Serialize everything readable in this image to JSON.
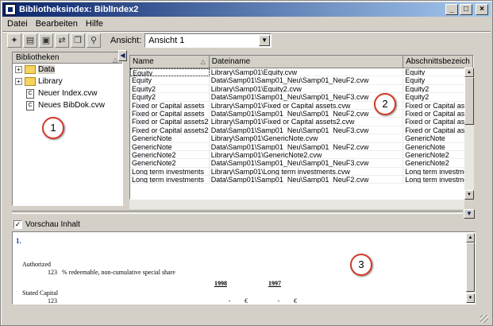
{
  "window": {
    "title": "Bibliotheksindex: BiblIndex2"
  },
  "menu": [
    "Datei",
    "Bearbeiten",
    "Hilfe"
  ],
  "toolbar": {
    "icons": [
      "new-library-icon",
      "library-list-icon",
      "monitor-icon",
      "connection-icon",
      "copy-icon",
      "binoculars-icon"
    ],
    "ansicht_label": "Ansicht:",
    "ansicht_value": "Ansicht 1"
  },
  "library_tree": {
    "header": "Bibliotheken",
    "items": [
      {
        "label": "Data",
        "type": "folder",
        "expandable": true,
        "selected": true
      },
      {
        "label": "Library",
        "type": "folder",
        "expandable": true,
        "selected": false
      },
      {
        "label": "Neuer Index.cvw",
        "type": "doc",
        "expandable": false,
        "selected": false
      },
      {
        "label": "Neues BibDok.cvw",
        "type": "doc",
        "expandable": false,
        "selected": false
      }
    ]
  },
  "table": {
    "headers": [
      "Name",
      "Dateiname",
      "Abschnittsbezeich"
    ],
    "rows": [
      [
        "Equity",
        "Library\\Samp01\\Equity.cvw",
        "Equity"
      ],
      [
        "Equity",
        "Data\\Samp01\\Samp01_Neu\\Samp01_NeuF2.cvw",
        "Equity"
      ],
      [
        "Equity2",
        "Library\\Samp01\\Equity2.cvw",
        "Equity2"
      ],
      [
        "Equity2",
        "Data\\Samp01\\Samp01_Neu\\Samp01_NeuF3.cvw",
        "Equity2"
      ],
      [
        "Fixed or Capital assets",
        "Library\\Samp01\\Fixed or Capital assets.cvw",
        "Fixed or Capital ass"
      ],
      [
        "Fixed or Capital assets",
        "Data\\Samp01\\Samp01_Neu\\Samp01_NeuF2.cvw",
        "Fixed or Capital ass"
      ],
      [
        "Fixed or Capital assets2",
        "Library\\Samp01\\Fixed or Capital assets2.cvw",
        "Fixed or Capital ass"
      ],
      [
        "Fixed or Capital assets2",
        "Data\\Samp01\\Samp01_Neu\\Samp01_NeuF3.cvw",
        "Fixed or Capital ass"
      ],
      [
        "GenericNote",
        "Library\\Samp01\\GenericNote.cvw",
        "GenericNote"
      ],
      [
        "GenericNote",
        "Data\\Samp01\\Samp01_Neu\\Samp01_NeuF2.cvw",
        "GenericNote"
      ],
      [
        "GenericNote2",
        "Library\\Samp01\\GenericNote2.cvw",
        "GenericNote2"
      ],
      [
        "GenericNote2",
        "Data\\Samp01\\Samp01_Neu\\Samp01_NeuF3.cvw",
        "GenericNote2"
      ],
      [
        "Long term investments",
        "Library\\Samp01\\Long term investments.cvw",
        "Long term investme"
      ],
      [
        "Long term investments",
        "Data\\Samp01\\Samp01_Neu\\Samp01_NeuF2.cvw",
        "Long term investme"
      ]
    ]
  },
  "preview": {
    "checkbox_label": "Vorschau Inhalt",
    "number": "1.",
    "authorized": "Authorized",
    "auth_value": "123",
    "auth_desc": "% redeemable, non-cumulative special share",
    "year1": "1998",
    "year2": "1997",
    "stated_capital": "Stated Capital",
    "stated_value": "123",
    "dash": "-",
    "currency": "€"
  },
  "callouts": [
    "1",
    "2",
    "3"
  ]
}
